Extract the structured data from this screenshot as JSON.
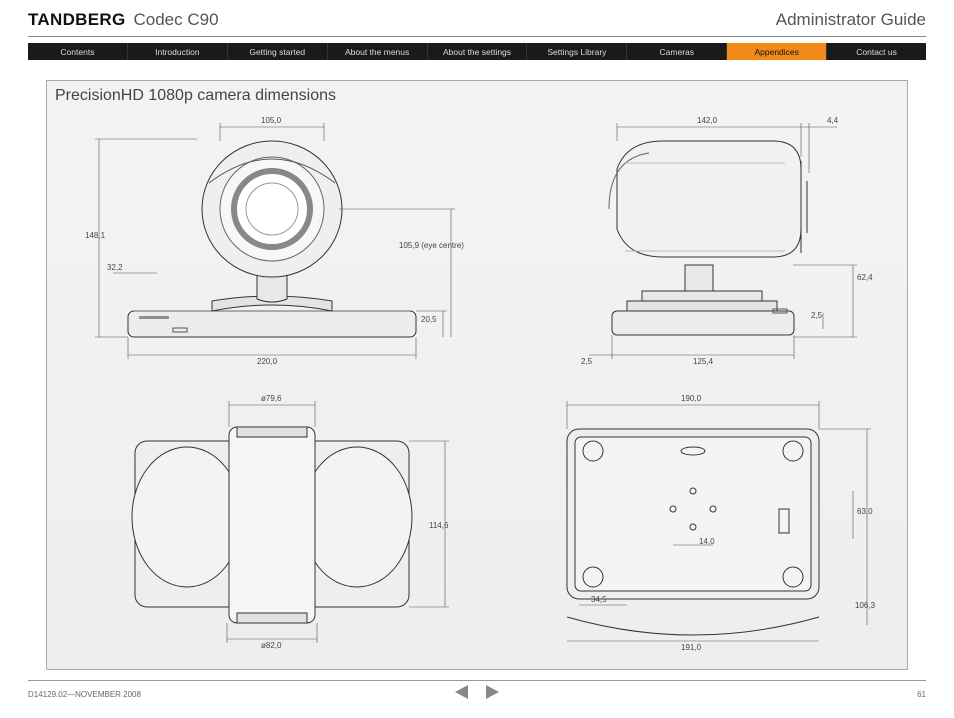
{
  "header": {
    "brand": "TANDBERG",
    "product": "Codec C90",
    "right": "Administrator Guide"
  },
  "nav": {
    "items": [
      {
        "label": "Contents",
        "active": false
      },
      {
        "label": "Introduction",
        "active": false
      },
      {
        "label": "Getting started",
        "active": false
      },
      {
        "label": "About the menus",
        "active": false
      },
      {
        "label": "About the settings",
        "active": false
      },
      {
        "label": "Settings Library",
        "active": false
      },
      {
        "label": "Cameras",
        "active": false
      },
      {
        "label": "Appendices",
        "active": true
      },
      {
        "label": "Contact us",
        "active": false
      }
    ]
  },
  "section": {
    "title": "PrecisionHD 1080p camera dimensions"
  },
  "dimensions": {
    "front": {
      "overall_height": "148,1",
      "top_width": "105,0",
      "neck_offset": "32,2",
      "base_width": "220,0",
      "base_height": "20,5",
      "eye_centre": "105,9  (eye centre)"
    },
    "side": {
      "top_depth": "142,0",
      "nose": "4,4",
      "base_depth": "125,4",
      "base_side_height": "62,4",
      "foot": "2,5",
      "front_clearance": "2,5"
    },
    "top": {
      "neck_dia": "ø79,6",
      "base_dia": "ø82,0",
      "depth": "114,6"
    },
    "bottom": {
      "width": "190,0",
      "inner_width": "191,0",
      "hole_spacing": "14,0",
      "front_offset": "34,5",
      "depth": "63,0",
      "overall_depth": "106,3"
    }
  },
  "footer": {
    "doc_id": "D14129.02—NOVEMBER 2008",
    "page": "61"
  }
}
